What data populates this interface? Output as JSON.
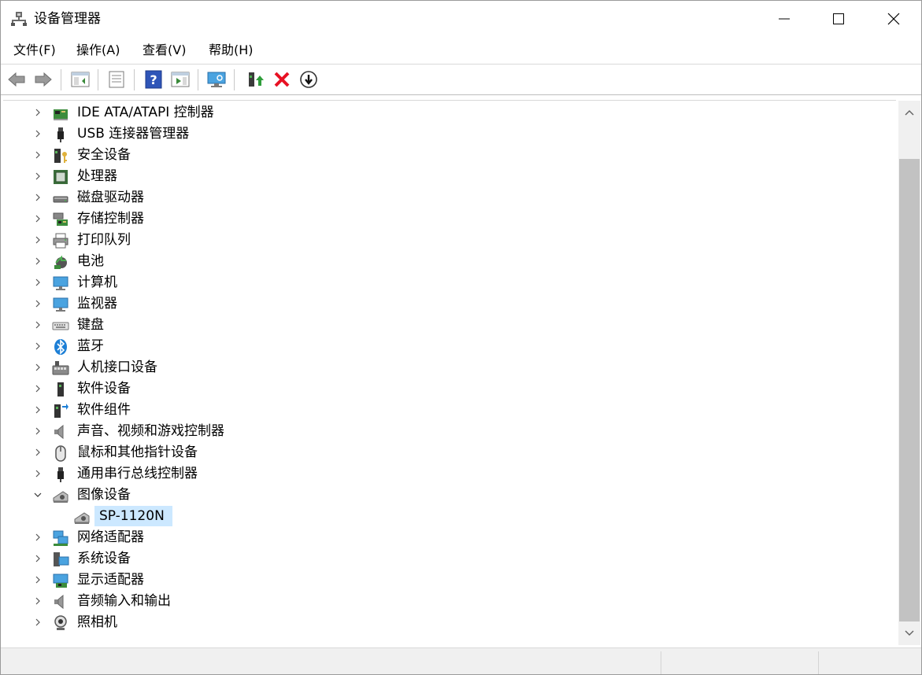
{
  "window": {
    "title": "设备管理器"
  },
  "menu": [
    "文件(F)",
    "操作(A)",
    "查看(V)",
    "帮助(H)"
  ],
  "toolbar": [
    {
      "icon": "back-arrow-icon"
    },
    {
      "icon": "forward-arrow-icon"
    },
    {
      "icon": "show-hide-console-tree-icon"
    },
    {
      "icon": "properties-icon"
    },
    {
      "icon": "help-icon"
    },
    {
      "icon": "run-view-icon"
    },
    {
      "icon": "scan-hardware-changes-icon"
    },
    {
      "icon": "update-driver-icon"
    },
    {
      "icon": "uninstall-device-icon"
    },
    {
      "icon": "disable-device-download-icon"
    }
  ],
  "tree": [
    {
      "label": "IDE ATA/ATAPI 控制器",
      "icon": "ide-controller-icon",
      "expanded": false
    },
    {
      "label": "USB 连接器管理器",
      "icon": "usb-connector-icon",
      "expanded": false
    },
    {
      "label": "安全设备",
      "icon": "security-device-icon",
      "expanded": false
    },
    {
      "label": "处理器",
      "icon": "processor-icon",
      "expanded": false
    },
    {
      "label": "磁盘驱动器",
      "icon": "disk-drive-icon",
      "expanded": false
    },
    {
      "label": "存储控制器",
      "icon": "storage-controller-icon",
      "expanded": false
    },
    {
      "label": "打印队列",
      "icon": "printer-icon",
      "expanded": false
    },
    {
      "label": "电池",
      "icon": "battery-icon",
      "expanded": false
    },
    {
      "label": "计算机",
      "icon": "computer-icon",
      "expanded": false
    },
    {
      "label": "监视器",
      "icon": "monitor-icon",
      "expanded": false
    },
    {
      "label": "键盘",
      "icon": "keyboard-icon",
      "expanded": false
    },
    {
      "label": "蓝牙",
      "icon": "bluetooth-icon",
      "expanded": false
    },
    {
      "label": "人机接口设备",
      "icon": "hid-icon",
      "expanded": false
    },
    {
      "label": "软件设备",
      "icon": "software-device-icon",
      "expanded": false
    },
    {
      "label": "软件组件",
      "icon": "software-component-icon",
      "expanded": false
    },
    {
      "label": "声音、视频和游戏控制器",
      "icon": "speaker-icon",
      "expanded": false
    },
    {
      "label": "鼠标和其他指针设备",
      "icon": "mouse-icon",
      "expanded": false
    },
    {
      "label": "通用串行总线控制器",
      "icon": "usb-controller-icon",
      "expanded": false
    },
    {
      "label": "图像设备",
      "icon": "imaging-device-icon",
      "expanded": true
    },
    {
      "label": "SP-1120N",
      "icon": "scanner-icon",
      "child": true,
      "selected": true
    },
    {
      "label": "网络适配器",
      "icon": "network-adapter-icon",
      "expanded": false
    },
    {
      "label": "系统设备",
      "icon": "system-device-icon",
      "expanded": false
    },
    {
      "label": "显示适配器",
      "icon": "display-adapter-icon",
      "expanded": false
    },
    {
      "label": "音频输入和输出",
      "icon": "audio-io-icon",
      "expanded": false
    },
    {
      "label": "照相机",
      "icon": "camera-icon",
      "expanded": false
    }
  ],
  "colors": {
    "selection": "#cce8ff",
    "scrollbar_thumb": "#c2c2c2",
    "uninstall_red": "#e81123"
  }
}
